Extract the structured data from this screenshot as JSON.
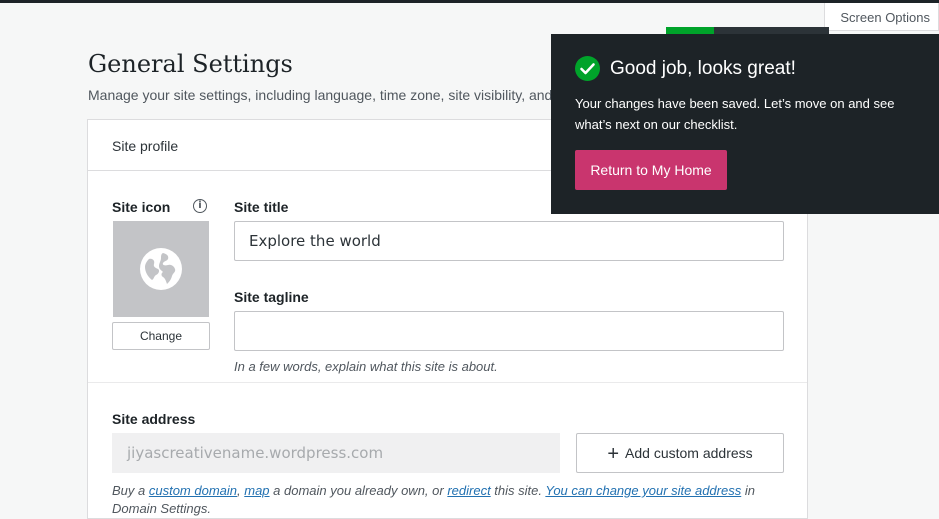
{
  "header": {
    "screen_options": "Screen Options"
  },
  "page": {
    "title": "General Settings",
    "subtitle": "Manage your site settings, including language, time zone, site visibility, and"
  },
  "site_profile": {
    "section_title": "Site profile",
    "site_icon_label": "Site icon",
    "info_icon": "i",
    "change_button": "Change",
    "site_title_label": "Site title",
    "site_title_value": "Explore the world",
    "site_tagline_label": "Site tagline",
    "site_tagline_value": "",
    "tagline_help": "In a few words, explain what this site is about.",
    "site_address_label": "Site address",
    "site_address_value": "jiyascreativename.wordpress.com",
    "add_custom_address": "Add custom address",
    "address_help": {
      "prefix": "Buy a ",
      "custom_domain": "custom domain",
      "comma": ", ",
      "map": "map",
      "middle": " a domain you already own, or ",
      "redirect": "redirect",
      "suffix": " this site. ",
      "change_link": "You can change your site address",
      "trailing": " in Domain Settings."
    }
  },
  "toast": {
    "title": "Good job, looks great!",
    "body": "Your changes have been saved. Let’s move on and see what’s next on our checklist.",
    "button": "Return to My Home"
  },
  "colors": {
    "accent_pink": "#c9356e",
    "success_green": "#00a32a",
    "toast_bg": "#1d2327",
    "link_blue": "#2271b1"
  },
  "icons": {
    "site_icon_placeholder": "globe-icon",
    "toast_icon": "checkmark-icon",
    "add_icon": "plus-icon"
  }
}
